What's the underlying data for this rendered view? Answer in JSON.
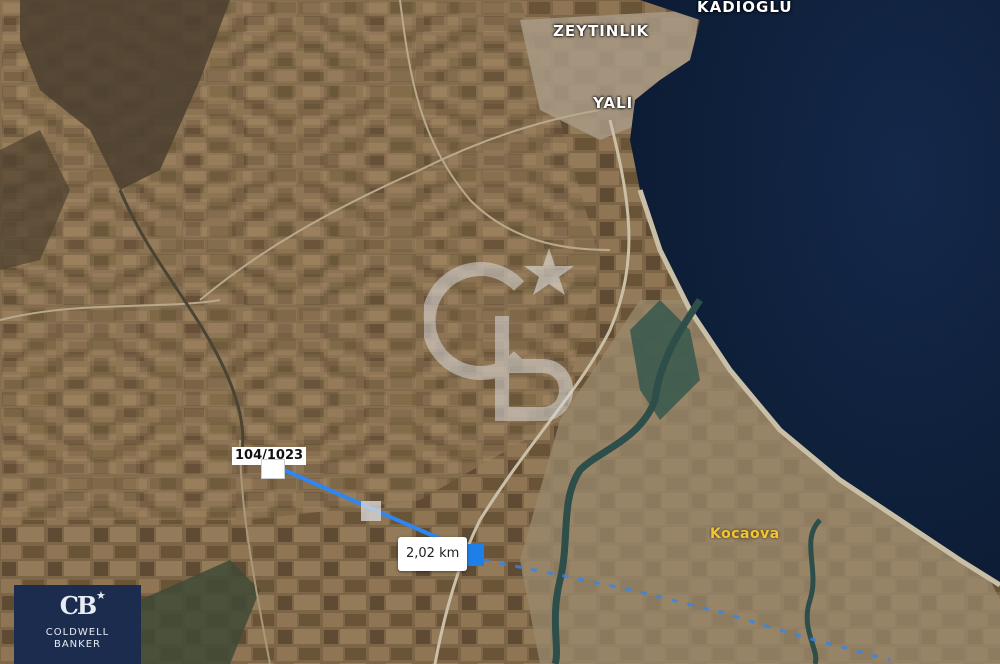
{
  "map": {
    "places": {
      "kadioglu": "KADIOĞLU",
      "zeytinlik": "ZEYTINLIK",
      "yali": "YALI",
      "kocaova": "Kocaova"
    },
    "parcel_label": "104/1023",
    "distance_label": "2,02 km",
    "logo": {
      "monogram": "CB",
      "line1": "COLDWELL",
      "line2": "BANKER"
    },
    "watermark": "CB",
    "colors": {
      "sea": "#0f2038",
      "land": "#7a6446",
      "route": "#2f86f0",
      "logo_bg": "#1b2c4e",
      "place_gold": "#f3c531"
    }
  }
}
